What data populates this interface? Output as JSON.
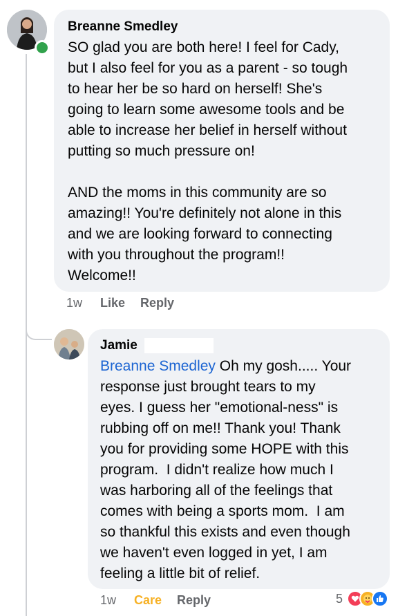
{
  "comment": {
    "author": "Breanne Smedley",
    "text": "SO glad you are both here! I feel for Cady,\nbut I also feel for you as a parent - so tough\nto hear her be so hard on herself! She's\ngoing to learn some awesome tools and be\nable to increase her belief in herself without\nputting so much pressure on!\n\nAND the moms in this community are so\namazing!! You're definitely not alone in this\nand we are looking forward to connecting\nwith you throughout the program!!\nWelcome!!",
    "time": "1w",
    "like_label": "Like",
    "reply_label": "Reply"
  },
  "reply": {
    "author": "Jamie",
    "mention": "Breanne Smedley",
    "text": " Oh my gosh..... Your\nresponse just brought tears to my\neyes. I guess her \"emotional-ness\" is\nrubbing off on me!! Thank you! Thank\nyou for providing some HOPE with this\nprogram.  I didn't realize how much I\nwas harboring all of the feelings that\ncomes with being a sports mom.  I am\nso thankful this exists and even though\nwe haven't even logged in yet, I am\nfeeling a little bit of relief.",
    "time": "1w",
    "care_label": "Care",
    "reply_label": "Reply",
    "reaction_count": "5",
    "reaction_icons": [
      "love-icon",
      "care-icon",
      "like-icon"
    ]
  },
  "colors": {
    "bubble": "#f0f2f5",
    "mention": "#1b64d2",
    "care": "#f7b125",
    "online": "#31a24c"
  }
}
